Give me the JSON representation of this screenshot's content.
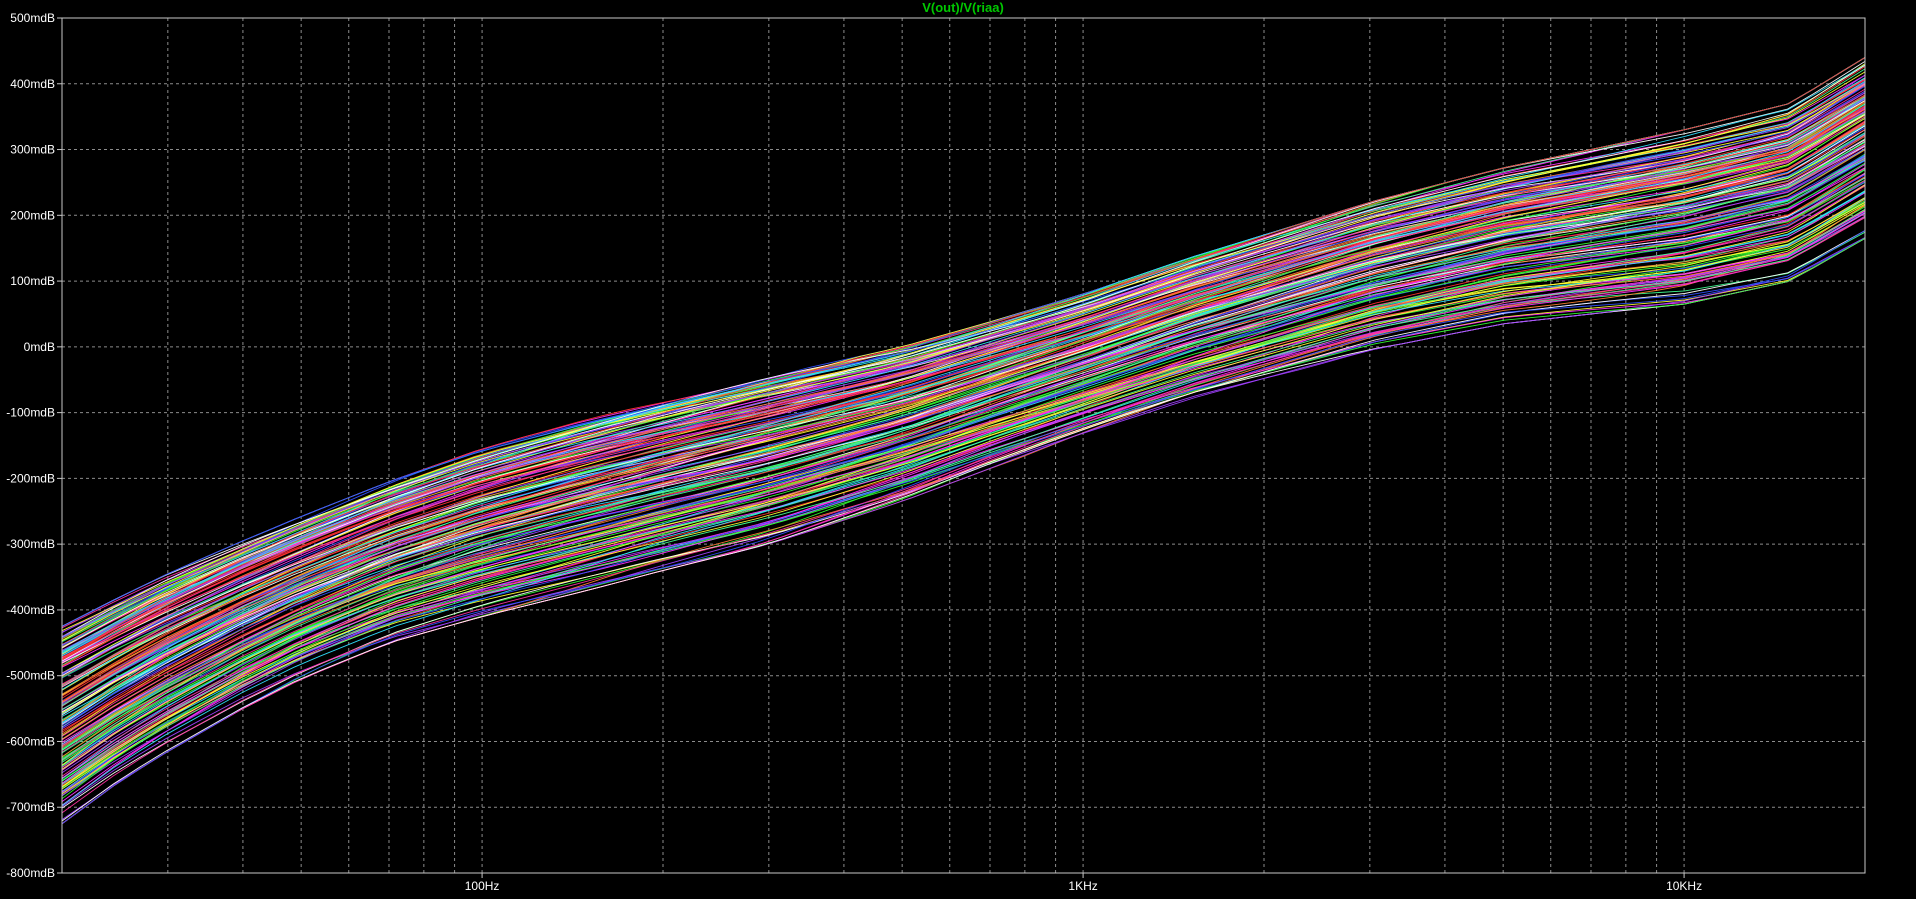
{
  "chart_data": {
    "type": "line",
    "title": "V(out)/V(riaa)",
    "title_color": "#00c800",
    "background": "#000000",
    "xscale": "log",
    "xlim": [
      20,
      20000
    ],
    "ylim": [
      -800,
      500
    ],
    "y_unit": "mdB",
    "grid": true,
    "y_ticks": [
      {
        "value": 500,
        "label": "500mdB"
      },
      {
        "value": 400,
        "label": "400mdB"
      },
      {
        "value": 300,
        "label": "300mdB"
      },
      {
        "value": 200,
        "label": "200mdB"
      },
      {
        "value": 100,
        "label": "100mdB"
      },
      {
        "value": 0,
        "label": "0mdB"
      },
      {
        "value": -100,
        "label": "-100mdB"
      },
      {
        "value": -200,
        "label": "-200mdB"
      },
      {
        "value": -300,
        "label": "-300mdB"
      },
      {
        "value": -400,
        "label": "-400mdB"
      },
      {
        "value": -500,
        "label": "-500mdB"
      },
      {
        "value": -600,
        "label": "-600mdB"
      },
      {
        "value": -700,
        "label": "-700mdB"
      },
      {
        "value": -800,
        "label": "-800mdB"
      }
    ],
    "x_ticks": [
      {
        "value": 100,
        "label": "100Hz"
      },
      {
        "value": 1000,
        "label": "1KHz"
      },
      {
        "value": 10000,
        "label": "10KHz"
      }
    ],
    "series_colors": [
      "#ff3030",
      "#3050ff",
      "#ff30ff",
      "#30ff30",
      "#30e0ff",
      "#ff30a0",
      "#ffffff",
      "#ffff30",
      "#a040ff",
      "#ff8030",
      "#40ff90"
    ],
    "band": {
      "x": [
        20,
        25,
        30,
        40,
        50,
        70,
        100,
        150,
        200,
        300,
        500,
        700,
        1000,
        1500,
        2000,
        3000,
        5000,
        7000,
        10000,
        15000,
        20000
      ],
      "upper": [
        -425,
        -380,
        -345,
        -295,
        -258,
        -205,
        -155,
        -110,
        -82,
        -45,
        0,
        38,
        80,
        135,
        170,
        220,
        272,
        300,
        330,
        370,
        440
      ],
      "lower": [
        -725,
        -660,
        -615,
        -550,
        -505,
        -450,
        -410,
        -370,
        -340,
        -300,
        -235,
        -185,
        -135,
        -82,
        -50,
        -5,
        35,
        50,
        65,
        100,
        165
      ]
    },
    "trace_count": 200
  }
}
